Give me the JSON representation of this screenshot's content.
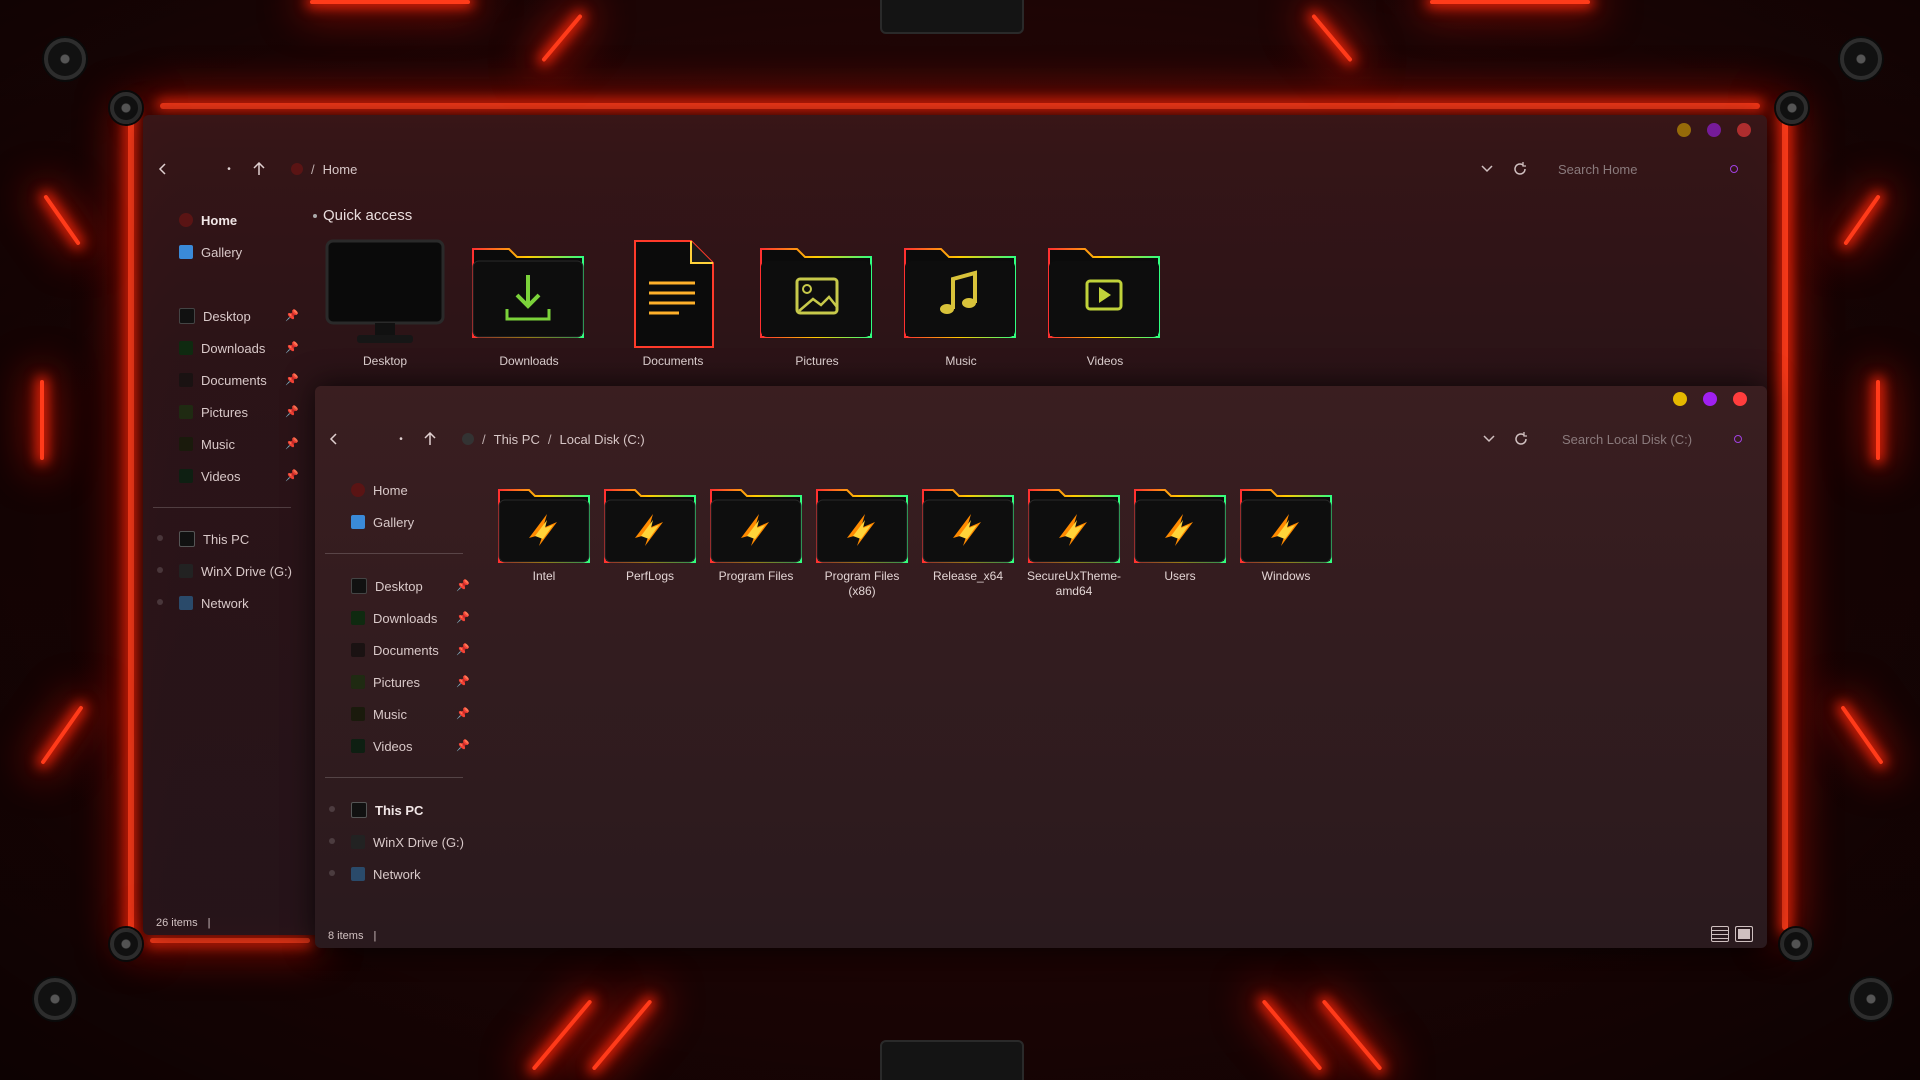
{
  "colors": {
    "dot_min": "#e5b800",
    "dot_max": "#a020f0",
    "dot_close": "#ff3d3d",
    "neon": "#ff3b1a",
    "aorus": "#ff8a00"
  },
  "window_home": {
    "breadcrumb": {
      "current": "Home"
    },
    "search_placeholder": "Search Home",
    "section_title": "Quick access",
    "sidebar": {
      "top": [
        {
          "label": "Home",
          "icon": "home-icon"
        },
        {
          "label": "Gallery",
          "icon": "gallery-icon"
        }
      ],
      "pinned": [
        {
          "label": "Desktop",
          "icon": "desktop-icon"
        },
        {
          "label": "Downloads",
          "icon": "downloads-icon"
        },
        {
          "label": "Documents",
          "icon": "documents-icon"
        },
        {
          "label": "Pictures",
          "icon": "pictures-icon"
        },
        {
          "label": "Music",
          "icon": "music-icon"
        },
        {
          "label": "Videos",
          "icon": "videos-icon"
        }
      ],
      "drives": [
        {
          "label": "This PC",
          "icon": "pc-icon"
        },
        {
          "label": "WinX Drive (G:)",
          "icon": "drive-icon"
        },
        {
          "label": "Network",
          "icon": "network-icon"
        }
      ]
    },
    "quick_access": [
      {
        "label": "Desktop"
      },
      {
        "label": "Downloads"
      },
      {
        "label": "Documents"
      },
      {
        "label": "Pictures"
      },
      {
        "label": "Music"
      },
      {
        "label": "Videos"
      }
    ],
    "status": {
      "items": "26 items"
    }
  },
  "window_disk": {
    "breadcrumb": {
      "parent": "This PC",
      "current": "Local Disk (C:)"
    },
    "search_placeholder": "Search Local Disk (C:)",
    "sidebar": {
      "top": [
        {
          "label": "Home",
          "icon": "home-icon"
        },
        {
          "label": "Gallery",
          "icon": "gallery-icon"
        }
      ],
      "pinned": [
        {
          "label": "Desktop",
          "icon": "desktop-icon"
        },
        {
          "label": "Downloads",
          "icon": "downloads-icon"
        },
        {
          "label": "Documents",
          "icon": "documents-icon"
        },
        {
          "label": "Pictures",
          "icon": "pictures-icon"
        },
        {
          "label": "Music",
          "icon": "music-icon"
        },
        {
          "label": "Videos",
          "icon": "videos-icon"
        }
      ],
      "drives": [
        {
          "label": "This PC",
          "icon": "pc-icon"
        },
        {
          "label": "WinX Drive (G:)",
          "icon": "drive-icon"
        },
        {
          "label": "Network",
          "icon": "network-icon"
        }
      ]
    },
    "folders": [
      {
        "label": "Intel"
      },
      {
        "label": "PerfLogs"
      },
      {
        "label": "Program Files"
      },
      {
        "label": "Program Files (x86)"
      },
      {
        "label": "Release_x64"
      },
      {
        "label": "SecureUxTheme-amd64"
      },
      {
        "label": "Users"
      },
      {
        "label": "Windows"
      }
    ],
    "status": {
      "items": "8 items"
    }
  }
}
